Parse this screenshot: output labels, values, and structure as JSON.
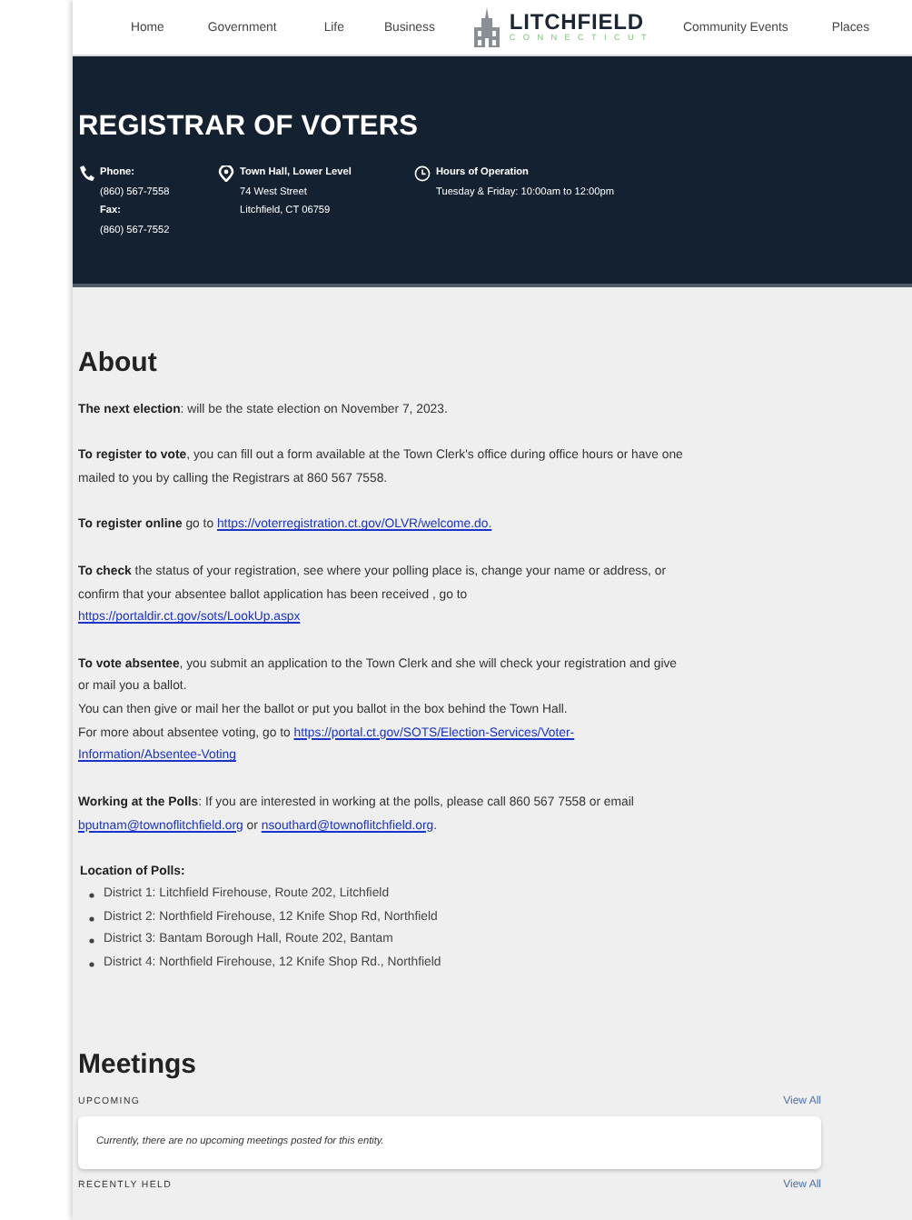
{
  "nav": {
    "items_left": [
      "Home",
      "Government",
      "Life",
      "Business"
    ],
    "logo": {
      "title": "LITCHFIELD",
      "subtitle": "CONNECTICUT"
    },
    "items_right": [
      "Community Events",
      "Places"
    ]
  },
  "header": {
    "title": "REGISTRAR OF VOTERS",
    "info": [
      {
        "kind": "phone",
        "lines": [
          {
            "text": "Phone:",
            "kind": "label"
          },
          {
            "text": "(860) 567-7558",
            "kind": "value"
          },
          {
            "text": "Fax:",
            "kind": "label"
          },
          {
            "text": "(860) 567-7552",
            "kind": "value"
          }
        ]
      },
      {
        "kind": "location",
        "lines": [
          {
            "text": "Town Hall, Lower Level",
            "kind": "label"
          },
          {
            "text": "74 West Street",
            "kind": "value"
          },
          {
            "text": "Litchfield, CT 06759",
            "kind": "value"
          }
        ]
      },
      {
        "kind": "clock",
        "lines": [
          {
            "text": "Hours of Operation",
            "kind": "label"
          },
          {
            "text": "Tuesday & Friday: 10:00am to 12:00pm",
            "kind": "value"
          }
        ]
      }
    ]
  },
  "about": {
    "title": "About",
    "paragraphs": [
      {
        "lines": [
          [
            {
              "kind": "bold",
              "text": "The next election"
            },
            {
              "kind": "text",
              "text": ": will be the state election on November 7, 2023."
            }
          ]
        ]
      },
      {
        "lines": [
          [
            {
              "kind": "bold",
              "text": "To register to vote"
            },
            {
              "kind": "text",
              "text": ", you can fill out a form available at the Town Clerk's office during office hours or have one"
            }
          ],
          [
            {
              "kind": "text",
              "text": "mailed to you by calling the Registrars at 860 567 7558."
            }
          ]
        ]
      },
      {
        "lines": [
          [
            {
              "kind": "bold",
              "text": "To register online"
            },
            {
              "kind": "text",
              "text": " go to "
            },
            {
              "kind": "link",
              "text": "https://voterregistration.ct.gov/OLVR/welcome.do."
            }
          ]
        ]
      },
      {
        "lines": [
          [
            {
              "kind": "bold",
              "text": "To check"
            },
            {
              "kind": "text",
              "text": " the status of your registration, see where your polling place is, change your name or address, or"
            }
          ],
          [
            {
              "kind": "text",
              "text": "confirm that your absentee ballot application has been received , go to"
            }
          ],
          [
            {
              "kind": "link",
              "text": "https://portaldir.ct.gov/sots/LookUp.aspx"
            }
          ]
        ]
      },
      {
        "lines": [
          [
            {
              "kind": "bold",
              "text": "To vote absentee"
            },
            {
              "kind": "text",
              "text": ", you submit an application to the Town Clerk and she will check your registration and give"
            }
          ],
          [
            {
              "kind": "text",
              "text": "or mail you a ballot."
            }
          ],
          [
            {
              "kind": "text",
              "text": "You can then give or mail her the ballot or put you ballot in the box behind the Town Hall."
            }
          ],
          [
            {
              "kind": "text",
              "text": "For more about absentee voting, go to "
            },
            {
              "kind": "link",
              "text": "https://portal.ct.gov/SOTS/Election-Services/Voter-"
            }
          ],
          [
            {
              "kind": "link",
              "text": "Information/Absentee-Voting"
            }
          ]
        ]
      },
      {
        "lines": [
          [
            {
              "kind": "bold",
              "text": "Working at the Polls"
            },
            {
              "kind": "text",
              "text": ":  If you are interested in working at the polls, please call 860 567 7558 or email"
            }
          ],
          [
            {
              "kind": "link",
              "text": "bputnam@townoflitchfield.org"
            },
            {
              "kind": "text",
              "text": " or "
            },
            {
              "kind": "link",
              "text": "nsouthard@townoflitchfield.org"
            },
            {
              "kind": "text",
              "text": "."
            }
          ]
        ]
      }
    ],
    "polls": {
      "title": "Location of Polls:",
      "items": [
        "District 1: Litchfield Firehouse, Route 202, Litchfield",
        "District 2: Northfield Firehouse, 12 Knife Shop Rd, Northfield",
        "District 3: Bantam Borough Hall, Route 202, Bantam",
        "District 4: Northfield Firehouse, 12 Knife Shop Rd., Northfield"
      ]
    }
  },
  "meetings": {
    "title": "Meetings",
    "sections": [
      {
        "label": "UPCOMING",
        "link": "View All",
        "message": "Currently, there are no upcoming meetings posted for this entity."
      },
      {
        "label": "RECENTLY HELD",
        "link": "View All"
      }
    ]
  }
}
